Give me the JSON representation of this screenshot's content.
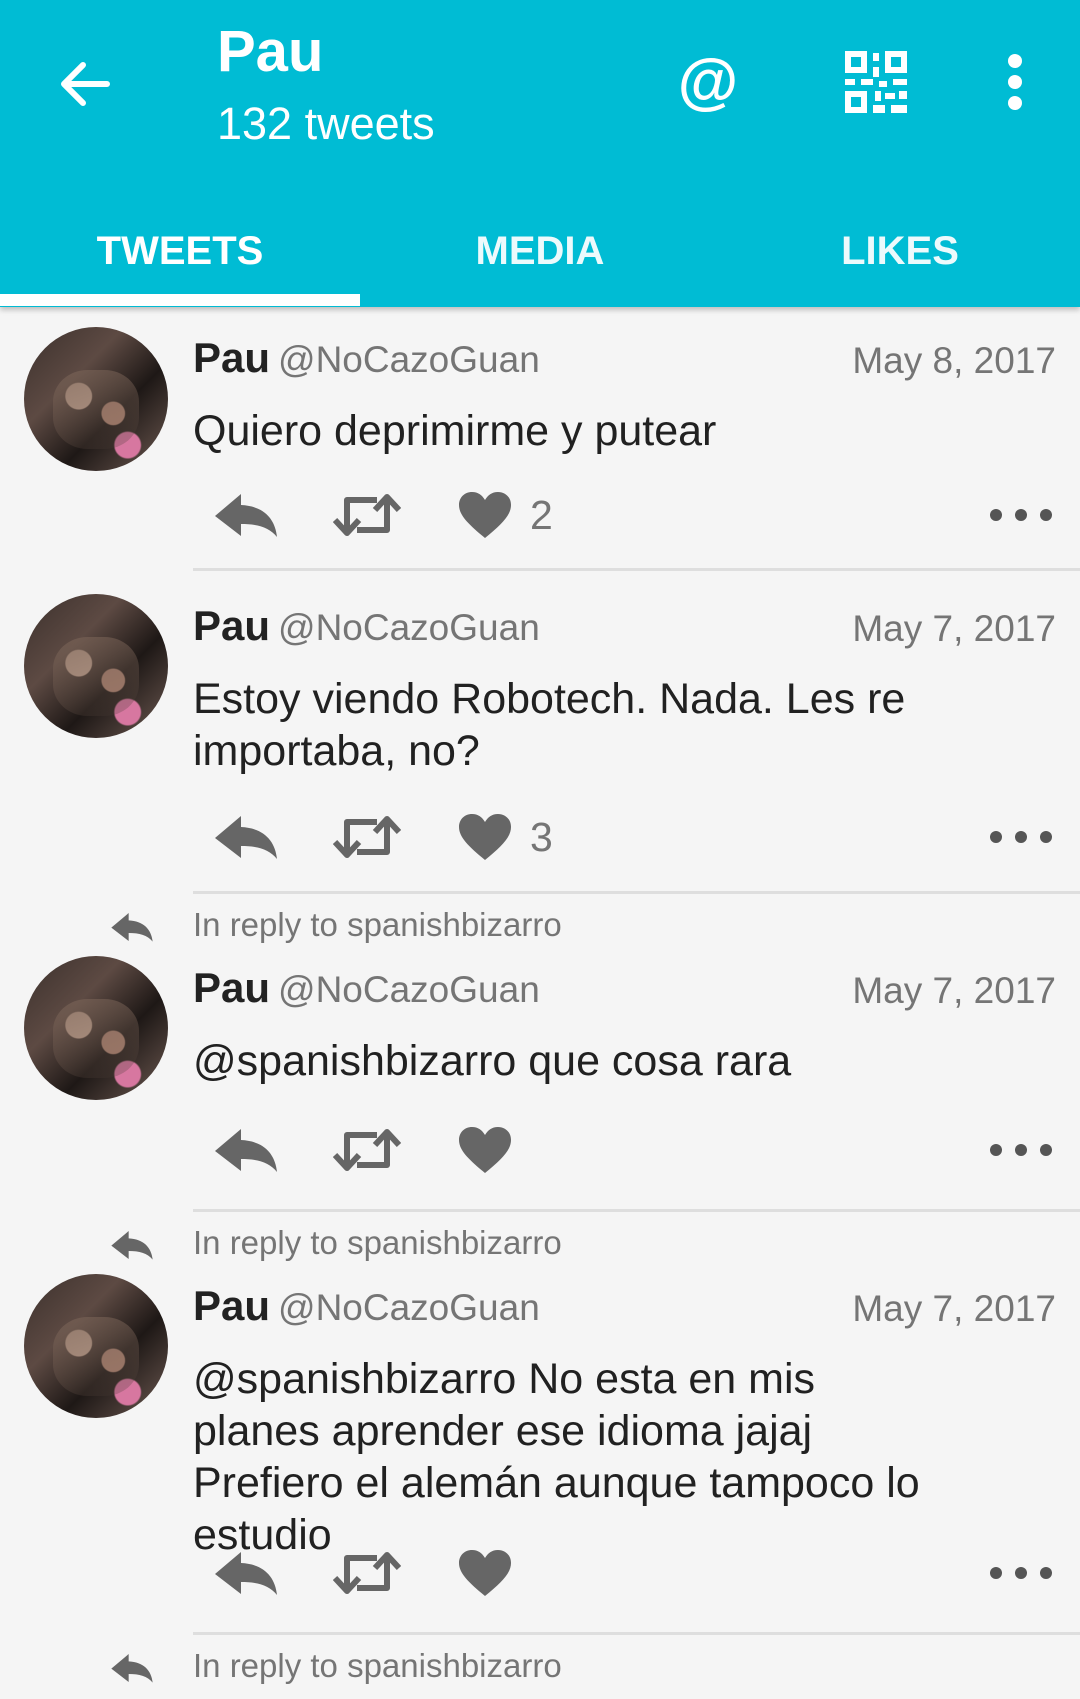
{
  "header": {
    "title": "Pau",
    "subtitle": "132 tweets",
    "mention_glyph": "@",
    "icons": [
      "arrow-back-icon",
      "at-icon",
      "qr-code-icon",
      "more-vert-icon"
    ],
    "background": "#00bcd4"
  },
  "tabs": [
    {
      "label": "TWEETS",
      "active": true
    },
    {
      "label": "MEDIA",
      "active": false
    },
    {
      "label": "LIKES",
      "active": false
    }
  ],
  "tweets": [
    {
      "reply_to": "",
      "name": "Pau",
      "handle": "@NoCazoGuan",
      "date": "May 8, 2017",
      "text": "Quiero deprimirme y putear",
      "likes": "2"
    },
    {
      "reply_to": "",
      "name": "Pau",
      "handle": "@NoCazoGuan",
      "date": "May 7, 2017",
      "text": "Estoy viendo Robotech. Nada. Les re importaba, no?",
      "likes": "3"
    },
    {
      "reply_to": "In reply to spanishbizarro",
      "name": "Pau",
      "handle": "@NoCazoGuan",
      "date": "May 7, 2017",
      "text": "@spanishbizarro que cosa rara",
      "likes": ""
    },
    {
      "reply_to": "In reply to spanishbizarro",
      "name": "Pau",
      "handle": "@NoCazoGuan",
      "date": "May 7, 2017",
      "text": "@spanishbizarro No esta en mis planes aprender ese idioma jajaj Prefiero el alemán aunque tampoco lo estudio",
      "likes": ""
    }
  ],
  "trailing_reply": "In reply to spanishbizarro"
}
